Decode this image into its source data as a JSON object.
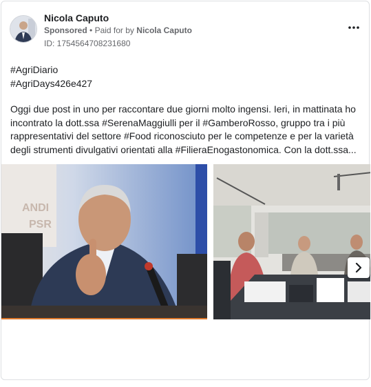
{
  "post": {
    "author": "Nicola Caputo",
    "sponsored_label": "Sponsored",
    "separator": "•",
    "paid_for_prefix": "Paid for by",
    "paid_for_name": "Nicola Caputo",
    "ad_id": "ID: 1754564708231680",
    "hashtag_line1": "#AgriDiario",
    "hashtag_line2": "#AgriDays426e427",
    "text_line1": "Oggi due post in uno per raccontare due giorni molto ingensi. Ieri, in mattinata ho",
    "text_line2": "incontrato la dott.ssa #SerenaMaggiulli per il #GamberoRosso, gruppo tra i più",
    "text_line3": "rappresentativi del settore #Food riconosciuto per le competenze e per la varietà",
    "text_line4": "degli strumenti divulgativi orientati alla #FilieraEnogastonomica. Con la dott.ssa..."
  },
  "icons": {
    "more": "more-horizontal-icon",
    "next": "chevron-right-icon"
  },
  "colors": {
    "text": "#1c1e21",
    "muted": "#65676b",
    "border": "#dddfe2",
    "accent_underline": "#e07a2c"
  }
}
